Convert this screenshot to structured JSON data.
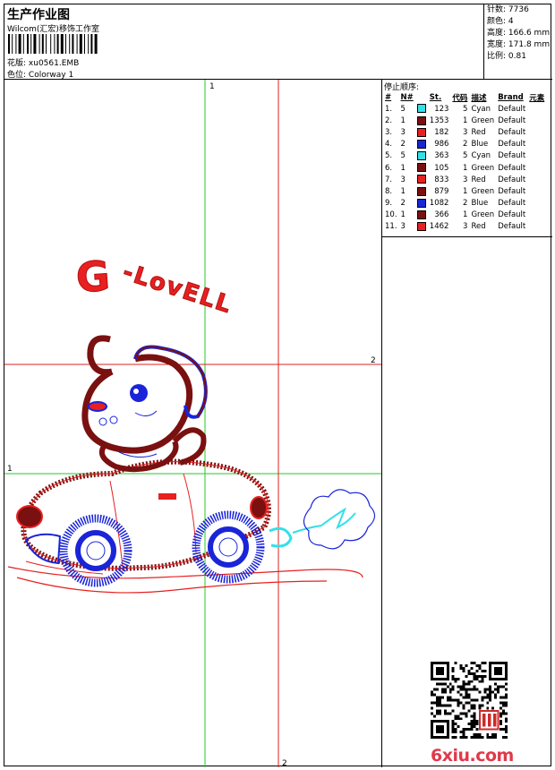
{
  "header": {
    "title": "生产作业图",
    "company": "Wilcom(汇宏)移饰工作室",
    "design_label": "花版:",
    "design_value": "xu0561.EMB",
    "colorway_label": "色位:",
    "colorway_value": "Colorway 1"
  },
  "stats": [
    {
      "label": "针数:",
      "value": "7736"
    },
    {
      "label": "颜色:",
      "value": "4"
    },
    {
      "label": "高度:",
      "value": "166.6 mm"
    },
    {
      "label": "宽度:",
      "value": "171.8 mm"
    },
    {
      "label": "比例:",
      "value": "0.81"
    }
  ],
  "sequence": {
    "title": "停止顺序:",
    "headers": [
      "#",
      "N#",
      "St.",
      "代码",
      "描述",
      "Brand",
      "元素"
    ],
    "rows": [
      {
        "idx": "1.",
        "n": "5",
        "color": "#33e0e8",
        "st": "123",
        "code": "5",
        "desc": "Cyan",
        "brand": "Default"
      },
      {
        "idx": "2.",
        "n": "1",
        "color": "#7a1010",
        "st": "1353",
        "code": "1",
        "desc": "Green",
        "brand": "Default"
      },
      {
        "idx": "3.",
        "n": "3",
        "color": "#e82020",
        "st": "182",
        "code": "3",
        "desc": "Red",
        "brand": "Default"
      },
      {
        "idx": "4.",
        "n": "2",
        "color": "#1a24d8",
        "st": "986",
        "code": "2",
        "desc": "Blue",
        "brand": "Default"
      },
      {
        "idx": "5.",
        "n": "5",
        "color": "#33e0e8",
        "st": "363",
        "code": "5",
        "desc": "Cyan",
        "brand": "Default"
      },
      {
        "idx": "6.",
        "n": "1",
        "color": "#7a1010",
        "st": "105",
        "code": "1",
        "desc": "Green",
        "brand": "Default"
      },
      {
        "idx": "7.",
        "n": "3",
        "color": "#e82020",
        "st": "833",
        "code": "3",
        "desc": "Red",
        "brand": "Default"
      },
      {
        "idx": "8.",
        "n": "1",
        "color": "#7a1010",
        "st": "879",
        "code": "1",
        "desc": "Green",
        "brand": "Default"
      },
      {
        "idx": "9.",
        "n": "2",
        "color": "#1a24d8",
        "st": "1082",
        "code": "2",
        "desc": "Blue",
        "brand": "Default"
      },
      {
        "idx": "10.",
        "n": "1",
        "color": "#7a1010",
        "st": "366",
        "code": "1",
        "desc": "Green",
        "brand": "Default"
      },
      {
        "idx": "11.",
        "n": "3",
        "color": "#e82020",
        "st": "1462",
        "code": "3",
        "desc": "Red",
        "brand": "Default"
      }
    ]
  },
  "canvas": {
    "marker_1": "1",
    "marker_2": "2",
    "design_text": "G-LovELL"
  },
  "colors": {
    "green_guide": "#22cc22",
    "red_guide": "#dd2222",
    "red": "#e82020",
    "maroon": "#7a1010",
    "blue": "#1a24d8",
    "cyan": "#33e0e8"
  },
  "watermark": "6xiu.com"
}
